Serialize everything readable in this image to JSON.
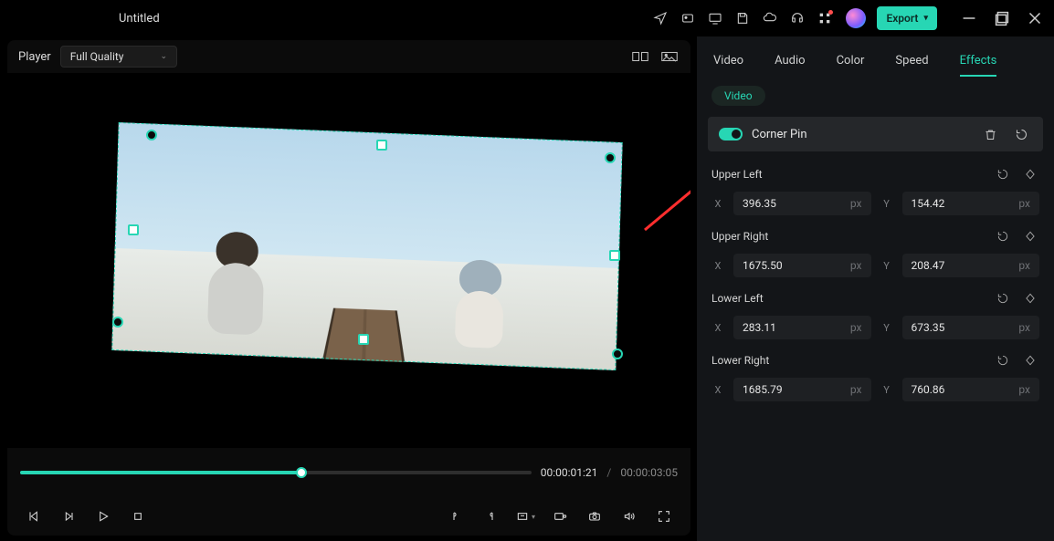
{
  "app": {
    "title": "Untitled"
  },
  "titlebar": {
    "export_label": "Export"
  },
  "player": {
    "label": "Player",
    "quality_selected": "Full Quality",
    "timecode_current": "00:00:01:21",
    "timecode_duration": "00:00:03:05",
    "seek_pct": 55
  },
  "inspector": {
    "tabs": [
      "Video",
      "Audio",
      "Color",
      "Speed",
      "Effects"
    ],
    "active_tab": 4,
    "chip_label": "Video",
    "effect": {
      "name": "Corner Pin",
      "enabled": true
    },
    "params": [
      {
        "label": "Upper Left",
        "x": "396.35",
        "y": "154.42"
      },
      {
        "label": "Upper Right",
        "x": "1675.50",
        "y": "208.47"
      },
      {
        "label": "Lower Left",
        "x": "283.11",
        "y": "673.35"
      },
      {
        "label": "Lower Right",
        "x": "1685.79",
        "y": "760.86"
      }
    ],
    "axis_x_label": "X",
    "axis_y_label": "Y",
    "unit_label": "px"
  }
}
